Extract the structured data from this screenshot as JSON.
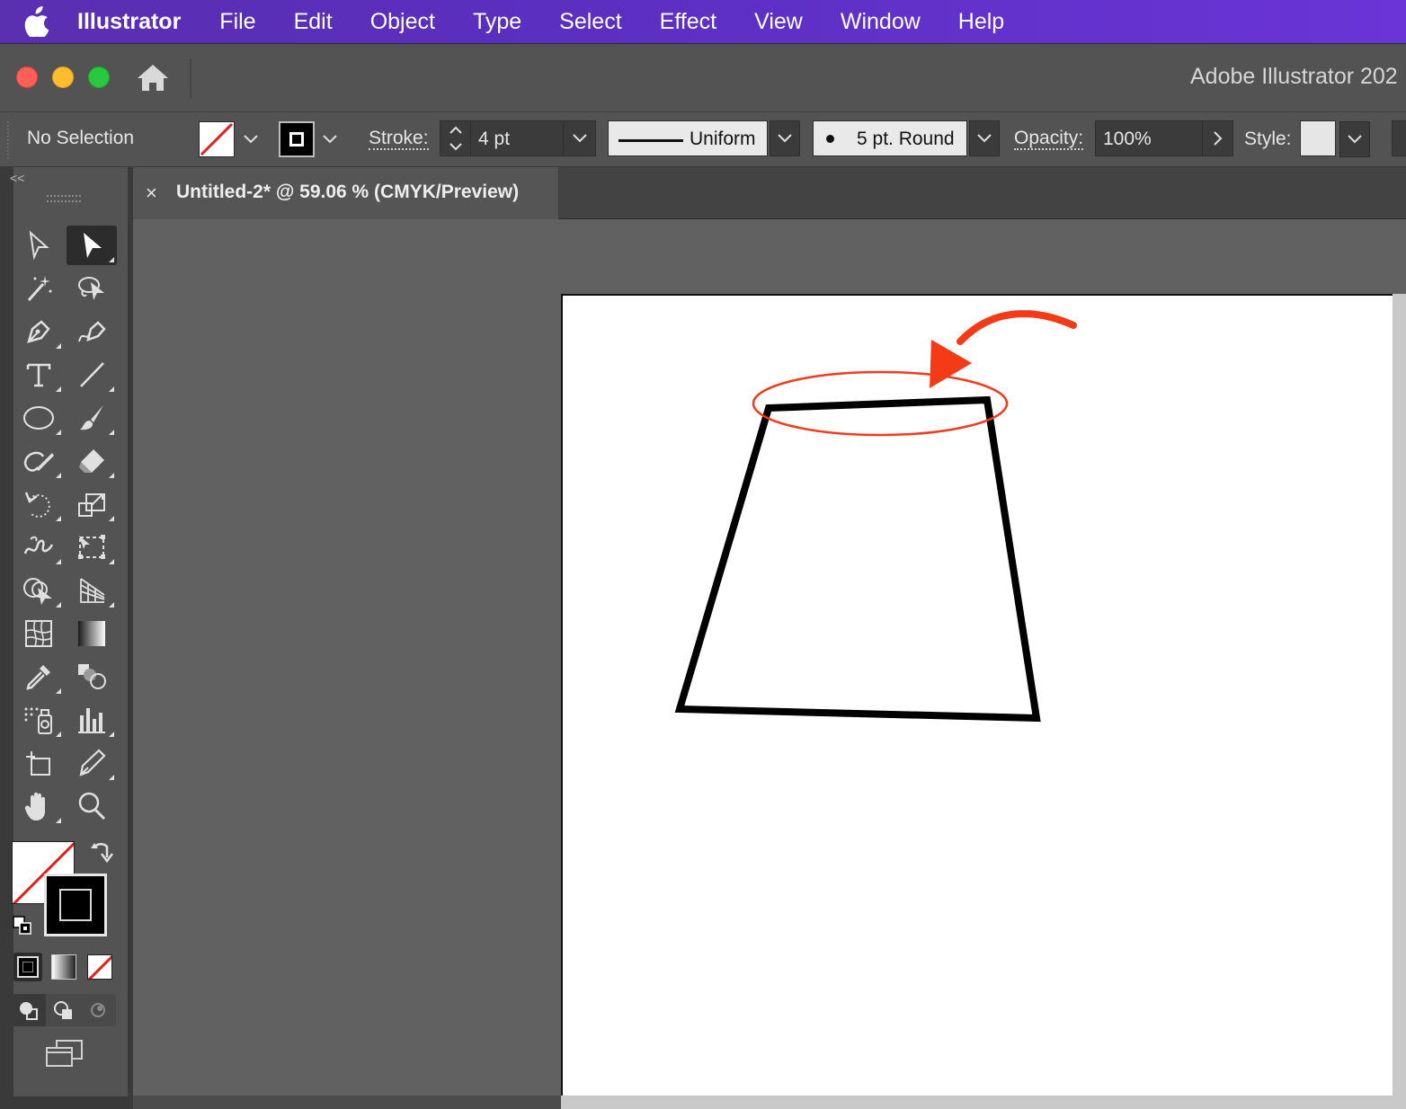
{
  "menubar": {
    "app_name": "Illustrator",
    "items": [
      "File",
      "Edit",
      "Object",
      "Type",
      "Select",
      "Effect",
      "View",
      "Window",
      "Help"
    ]
  },
  "window": {
    "title": "Adobe Illustrator 202"
  },
  "control_bar": {
    "selection_label": "No Selection",
    "stroke_label": "Stroke:",
    "stroke_weight": "4 pt",
    "profile": "Uniform",
    "brush": "5 pt. Round",
    "opacity_label": "Opacity:",
    "opacity_value": "100%",
    "style_label": "Style:"
  },
  "document_tab": {
    "title": "Untitled-2* @ 59.06 % (CMYK/Preview)",
    "close_symbol": "×"
  },
  "tools_panel": {
    "collapse_symbol": "<<"
  },
  "colors": {
    "menubar": "#5b2fc0",
    "annotation_red": "#f23a1c",
    "stroke_black": "#000000"
  }
}
